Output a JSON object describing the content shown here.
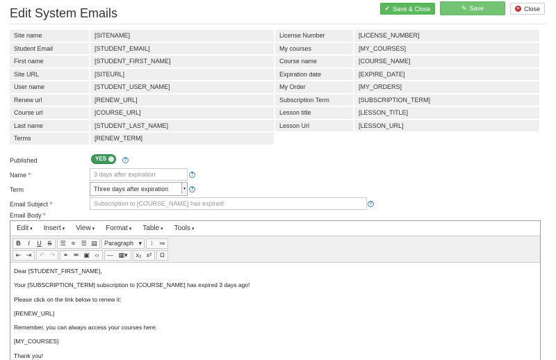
{
  "page": {
    "title": "Edit System Emails"
  },
  "actions": {
    "save_close": "Save & Close",
    "save": "Save",
    "close": "Close"
  },
  "tags": [
    [
      {
        "label": "Site name",
        "value": "[SITENAME]"
      },
      {
        "label": "License Number",
        "value": "[LICENSE_NUMBER]"
      }
    ],
    [
      {
        "label": "Student Email",
        "value": "[STUDENT_EMAIL]"
      },
      {
        "label": "My courses",
        "value": "[MY_COURSES]"
      }
    ],
    [
      {
        "label": "First name",
        "value": "[STUDENT_FIRST_NAME]"
      },
      {
        "label": "Course name",
        "value": "[COURSE_NAME]"
      }
    ],
    [
      {
        "label": "Site URL",
        "value": "[SITEURL]"
      },
      {
        "label": "Expiration date",
        "value": "[EXPIRE_DATE]"
      }
    ],
    [
      {
        "label": "User name",
        "value": "[STUDENT_USER_NAME]"
      },
      {
        "label": "My Order",
        "value": "[MY_ORDERS]"
      }
    ],
    [
      {
        "label": "Renew url",
        "value": "[RENEW_URL]"
      },
      {
        "label": "Subscription Term",
        "value": "[SUBSCRIPTION_TERM]"
      }
    ],
    [
      {
        "label": "Course url",
        "value": "[COURSE_URL]"
      },
      {
        "label": "Lesson title",
        "value": "[LESSON_TITLE]"
      }
    ],
    [
      {
        "label": "Last name",
        "value": "[STUDENT_LAST_NAME]"
      },
      {
        "label": "Lesson Url",
        "value": "[LESSON_URL]"
      }
    ],
    [
      {
        "label": "Terms",
        "value": "[RENEW_TERM]"
      }
    ]
  ],
  "form": {
    "published_label": "Published",
    "published_value": "YES",
    "name_label": "Name",
    "name_placeholder": "3 days after expiration",
    "term_label": "Term",
    "term_value": "Three days after expiration",
    "subject_label": "Email Subject",
    "subject_placeholder": "Subscription to [COURSE_NAME] has expired!",
    "body_label": "Email Body",
    "required_mark": "*",
    "help_glyph": "?"
  },
  "editor": {
    "menus": [
      "Edit",
      "Insert",
      "View",
      "Format",
      "Table",
      "Tools"
    ],
    "format_select": "Paragraph",
    "body": [
      "Dear [STUDENT_FIRST_NAME],",
      "Your [SUBSCRIPTION_TERM] subscription to [COURSE_NAME] has expired 3 days ago!",
      "Please click on the link below to renew it:",
      "[RENEW_URL]",
      "Remember, you can always access your courses here:",
      "[MY_COURSES]",
      "Thank you!"
    ]
  },
  "colors": {
    "green": "#5cb85c",
    "toggle_on": "#3c9a5a",
    "danger": "#c9302c",
    "help_blue": "#3a87c8"
  }
}
